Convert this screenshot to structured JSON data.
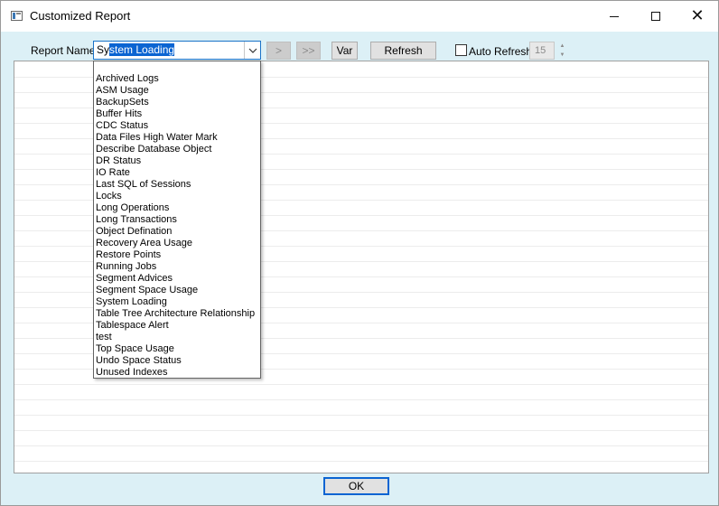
{
  "window": {
    "title": "Customized Report",
    "icon": "app-window-icon",
    "controls": {
      "minimize": "minimize-icon",
      "maximize": "maximize-icon",
      "close": "✕"
    }
  },
  "toolbar": {
    "report_label": "Report Name:",
    "report_value_prefix": "Sy",
    "report_value_selected": "stem Loading",
    "next_label": ">",
    "last_label": ">>",
    "var_label": "Var",
    "refresh_label": "Refresh",
    "auto_refresh_label": "Auto Refresh",
    "auto_refresh_checked": false,
    "interval_value": "15"
  },
  "dropdown": {
    "items": [
      "Archived Logs",
      "ASM Usage",
      "BackupSets",
      "Buffer Hits",
      "CDC Status",
      "Data Files High Water Mark",
      "Describe Database Object",
      "DR Status",
      "IO Rate",
      "Last SQL of Sessions",
      "Locks",
      "Long Operations",
      "Long Transactions",
      "Object Defination",
      "Recovery Area Usage",
      "Restore Points",
      "Running Jobs",
      "Segment Advices",
      "Segment Space Usage",
      "System Loading",
      "Table Tree Architecture Relationship",
      "Tablespace Alert",
      "test",
      "Top Space Usage",
      "Undo Space Status",
      "Unused Indexes"
    ]
  },
  "footer": {
    "ok_label": "OK"
  },
  "colors": {
    "accent": "#0a64d2",
    "dialog_bg": "#dcf0f6",
    "disabled_btn": "#cccccc"
  }
}
